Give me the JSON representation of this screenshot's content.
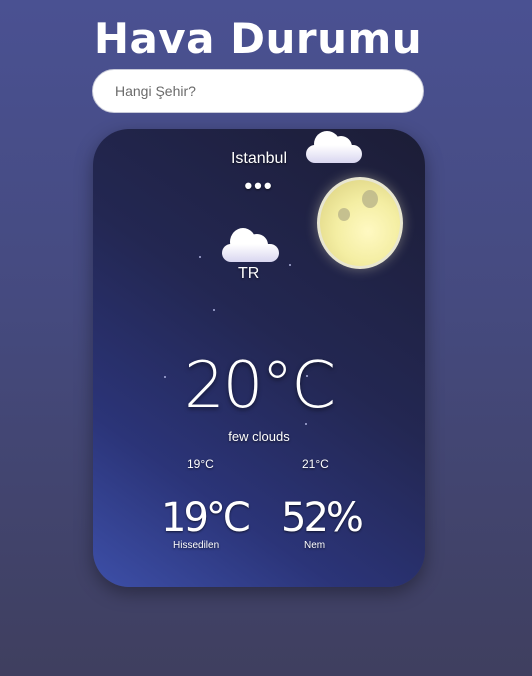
{
  "app": {
    "title": "Hava Durumu"
  },
  "search": {
    "placeholder": "Hangi Şehir?"
  },
  "weather": {
    "city": "Istanbul",
    "loading": "•••",
    "country": "TR",
    "temperature": "20°C",
    "description": "few clouds",
    "temp_min": "19°C",
    "temp_max": "21°C",
    "feels_like": "19°C",
    "feels_like_label": "Hissedilen",
    "humidity": "52%",
    "humidity_label": "Nem"
  },
  "icons": [
    "moon-icon",
    "cloud-icon"
  ],
  "colors": {
    "background": "#484d87",
    "card": "#232752",
    "moon": "#f4eea3"
  }
}
